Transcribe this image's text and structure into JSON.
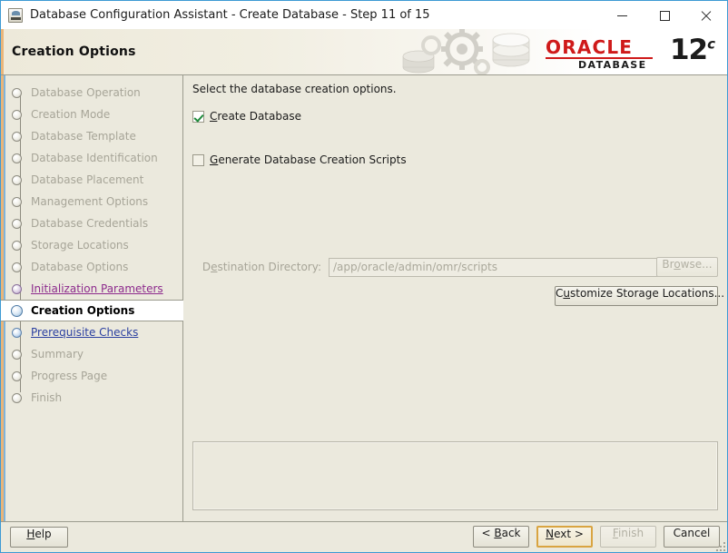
{
  "window": {
    "title": "Database Configuration Assistant - Create Database - Step 11 of 15",
    "icon": "dbca-app-icon",
    "controls": {
      "minimize": "minimize-icon",
      "maximize": "maximize-icon",
      "close": "close-icon"
    }
  },
  "banner": {
    "title": "Creation Options",
    "logo": {
      "wordmark": "ORACLE",
      "product": "DATABASE",
      "version_number": "12",
      "version_suffix": "c"
    },
    "accent_color": "#e9b57a",
    "brand_color": "#cf1a1a"
  },
  "sidebar": {
    "steps": [
      {
        "label": "Database Operation",
        "state": "done"
      },
      {
        "label": "Creation Mode",
        "state": "done"
      },
      {
        "label": "Database Template",
        "state": "done"
      },
      {
        "label": "Database Identification",
        "state": "done"
      },
      {
        "label": "Database Placement",
        "state": "done"
      },
      {
        "label": "Management Options",
        "state": "done"
      },
      {
        "label": "Database Credentials",
        "state": "done"
      },
      {
        "label": "Storage Locations",
        "state": "done"
      },
      {
        "label": "Database Options",
        "state": "done"
      },
      {
        "label": "Initialization Parameters",
        "state": "link-visited"
      },
      {
        "label": "Creation Options",
        "state": "current"
      },
      {
        "label": "Prerequisite Checks",
        "state": "link"
      },
      {
        "label": "Summary",
        "state": "done"
      },
      {
        "label": "Progress Page",
        "state": "done"
      },
      {
        "label": "Finish",
        "state": "done"
      }
    ]
  },
  "main": {
    "instruction": "Select the database creation options.",
    "create_database": {
      "label_pre": "",
      "mnemonic": "C",
      "label_post": "reate Database",
      "checked": true
    },
    "generate_scripts": {
      "label_pre": "",
      "mnemonic": "G",
      "label_post": "enerate Database Creation Scripts",
      "checked": false
    },
    "destination_directory": {
      "label_pre": "D",
      "mnemonic": "e",
      "label_post": "stination Directory:",
      "value": "/app/oracle/admin/omr/scripts",
      "placeholder": "",
      "disabled": true
    },
    "browse_button": {
      "label_pre": "Br",
      "mnemonic": "o",
      "label_post": "wse...",
      "disabled": true
    },
    "customize_button": {
      "label_pre": "C",
      "mnemonic": "u",
      "label_post": "stomize Storage Locations...",
      "disabled": false
    },
    "message_panel": {
      "text": ""
    }
  },
  "footer": {
    "help": {
      "label_pre": "",
      "mnemonic": "H",
      "label_post": "elp",
      "disabled": false
    },
    "back": {
      "label_pre": "< ",
      "mnemonic": "B",
      "label_post": "ack",
      "disabled": false
    },
    "next": {
      "label_pre": "",
      "mnemonic": "N",
      "label_post": "ext >",
      "disabled": false,
      "focused": true
    },
    "finish": {
      "label_pre": "",
      "mnemonic": "F",
      "label_post": "inish",
      "disabled": true
    },
    "cancel": {
      "label_pre": "Cancel",
      "mnemonic": "",
      "label_post": "",
      "disabled": false
    }
  }
}
